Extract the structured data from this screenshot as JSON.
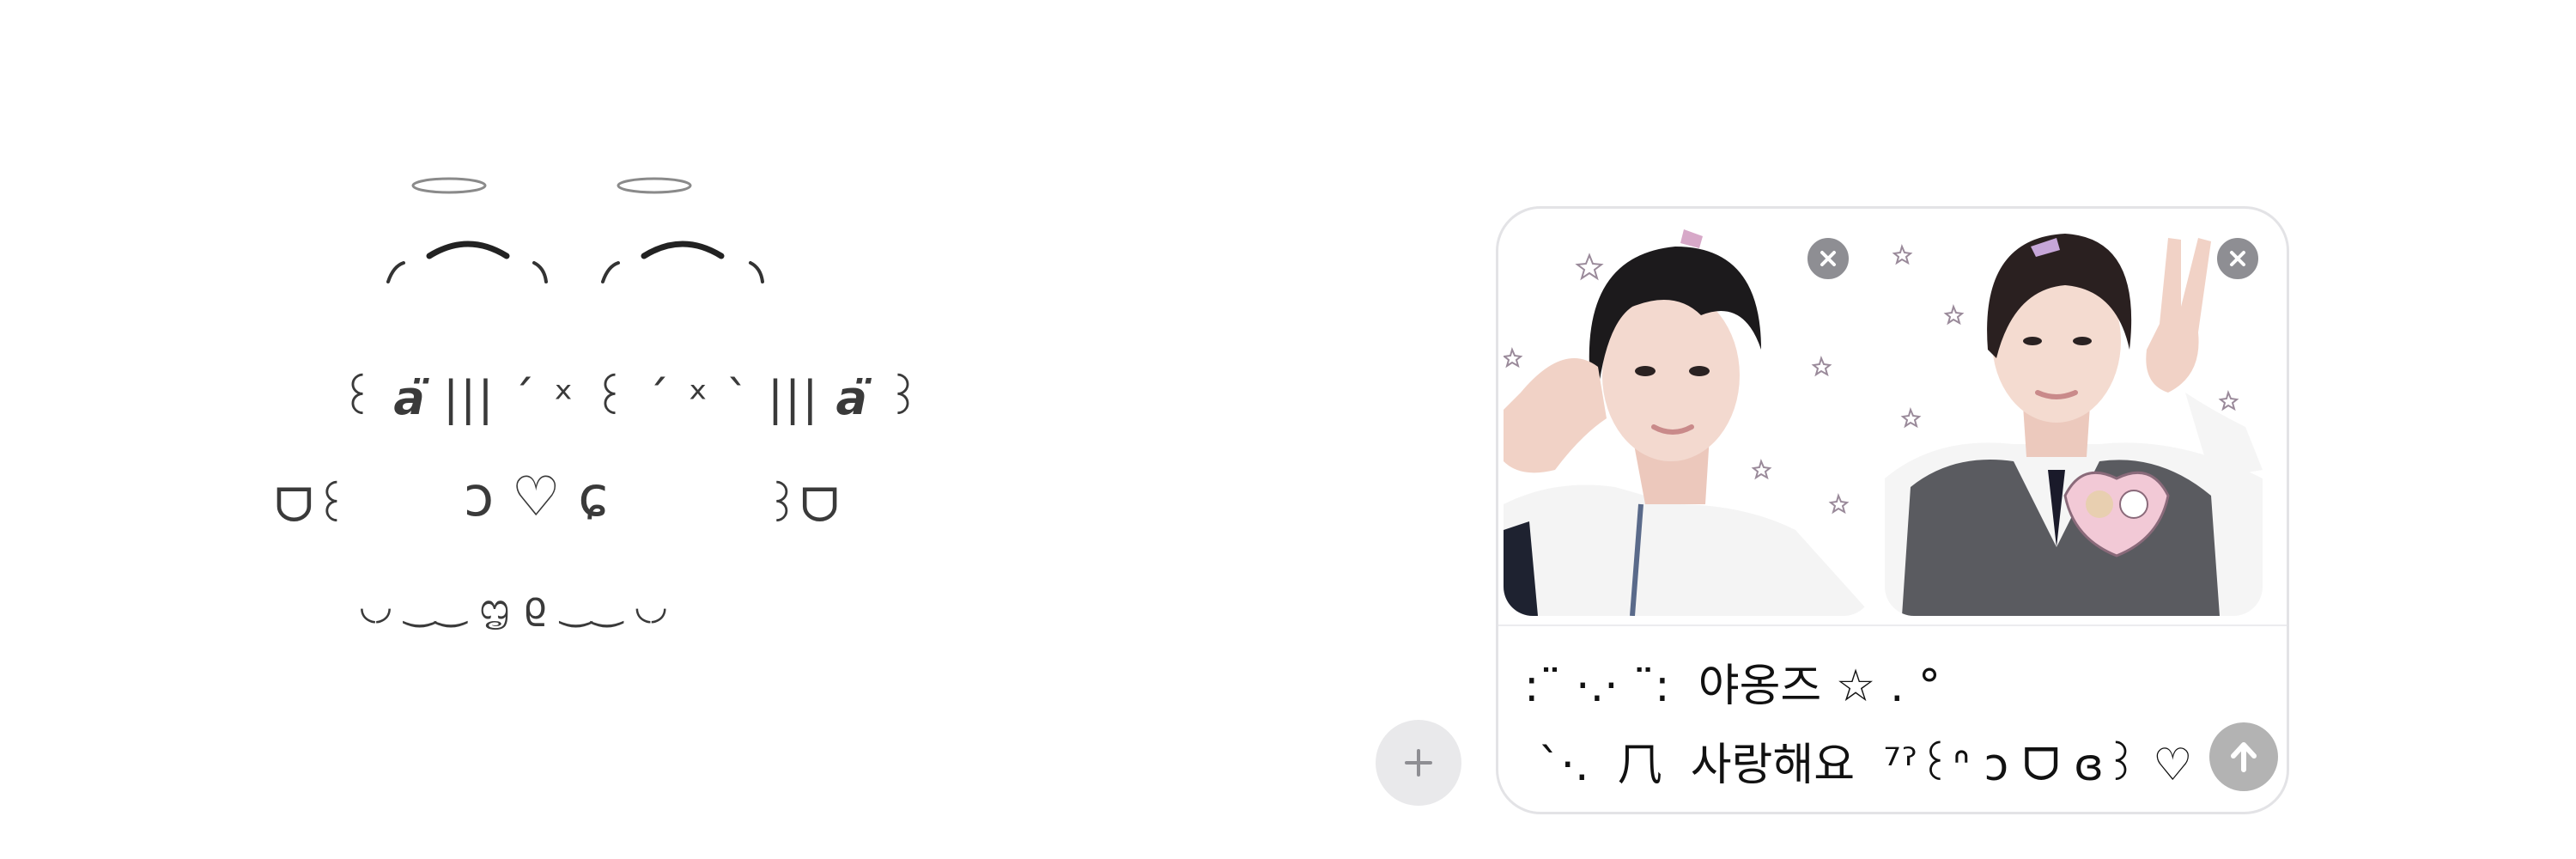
{
  "kaomoji_art": {
    "eyes_line": "꒰ 𝙖̈ ||| ´ ˣ ꒰ ´ ˣ ` ||| 𝙖̈ ꒱",
    "mouth_left": "ᗜ꒰",
    "mouth_center": "ɔ ♡ ɕ",
    "mouth_right": "꒱ᗜ",
    "bottom_line": "◟◞ ‿‿ ᦗ ϱ ‿‿ ◟◞"
  },
  "composer": {
    "attachments": [
      {
        "alt": "photo-1",
        "colors": {
          "bg": "#ffffff",
          "hair": "#1c1a1c",
          "skin": "#f3d9cf",
          "shirt": "#f4f4f4"
        }
      },
      {
        "alt": "photo-2",
        "colors": {
          "bg": "#ffffff",
          "hair": "#2a2020",
          "skin": "#f4dbd0",
          "vest": "#5a5b60"
        }
      }
    ],
    "message_lines": [
      ":¨ ·.· ¨:  야옹즈 ☆ . °",
      " `·.  ⺇  사랑해요  ⁷ˀ꒰ᐢ ɔ ᗜ ɞ꒱ ♡"
    ],
    "accent_colors": {
      "send": "#b3b3b3",
      "plus_bg": "#e9e9eb",
      "remove_bg": "#8e8e93"
    }
  }
}
